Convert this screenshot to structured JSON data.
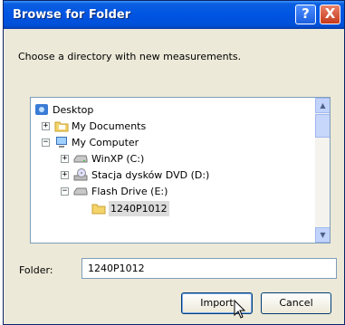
{
  "title": "Browse for Folder",
  "title_buttons": {
    "help": "?",
    "close": "X"
  },
  "instruction": "Choose a directory with new measurements.",
  "tree": {
    "items": [
      {
        "label": "Desktop",
        "expander": "",
        "icon": "desktop-icon"
      },
      {
        "label": "My Documents",
        "expander": "+",
        "icon": "documents-folder-icon"
      },
      {
        "label": "My Computer",
        "expander": "−",
        "icon": "computer-icon"
      },
      {
        "label": "WinXP (C:)",
        "expander": "+",
        "icon": "hard-drive-icon"
      },
      {
        "label": "Stacja dysków DVD (D:)",
        "expander": "+",
        "icon": "dvd-drive-icon"
      },
      {
        "label": "Flash Drive (E:)",
        "expander": "−",
        "icon": "flash-drive-icon"
      },
      {
        "label": "1240P1012",
        "expander": "",
        "icon": "folder-icon",
        "selected": true
      }
    ]
  },
  "folder": {
    "label": "Folder:",
    "value": "1240P1012"
  },
  "buttons": {
    "import": "Import",
    "cancel": "Cancel"
  },
  "colors": {
    "titlebar": "#0054e3",
    "dialog_bg": "#ece9d8",
    "close": "#c5391b"
  }
}
